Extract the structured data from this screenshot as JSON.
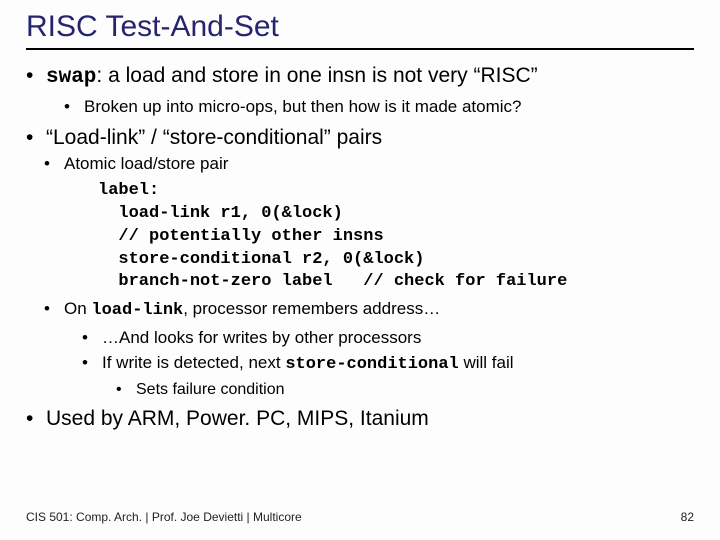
{
  "title": "RISC Test-And-Set",
  "b1": {
    "pre": "swap",
    "post": ": a load and store in one insn is not very “RISC”"
  },
  "b1a": "Broken up into micro-ops, but then how is it made atomic?",
  "b2": "“Load-link” / “store-conditional” pairs",
  "b2a": "Atomic load/store pair",
  "code": "label:\n  load-link r1, 0(&lock)\n  // potentially other insns\n  store-conditional r2, 0(&lock)\n  branch-not-zero label   // check for failure",
  "b2b": {
    "pre": "On ",
    "mono": "load-link",
    "post": ", processor remembers address…"
  },
  "b2b1": "…And looks for writes by other processors",
  "b2b2": {
    "pre": "If write is detected, next ",
    "mono": "store-conditional",
    "post": " will fail"
  },
  "b2b2a": "Sets failure condition",
  "b3": "Used by ARM, Power. PC, MIPS, Itanium",
  "footer_left": "CIS 501: Comp. Arch.  |  Prof. Joe Devietti  |  Multicore",
  "footer_right": "82"
}
